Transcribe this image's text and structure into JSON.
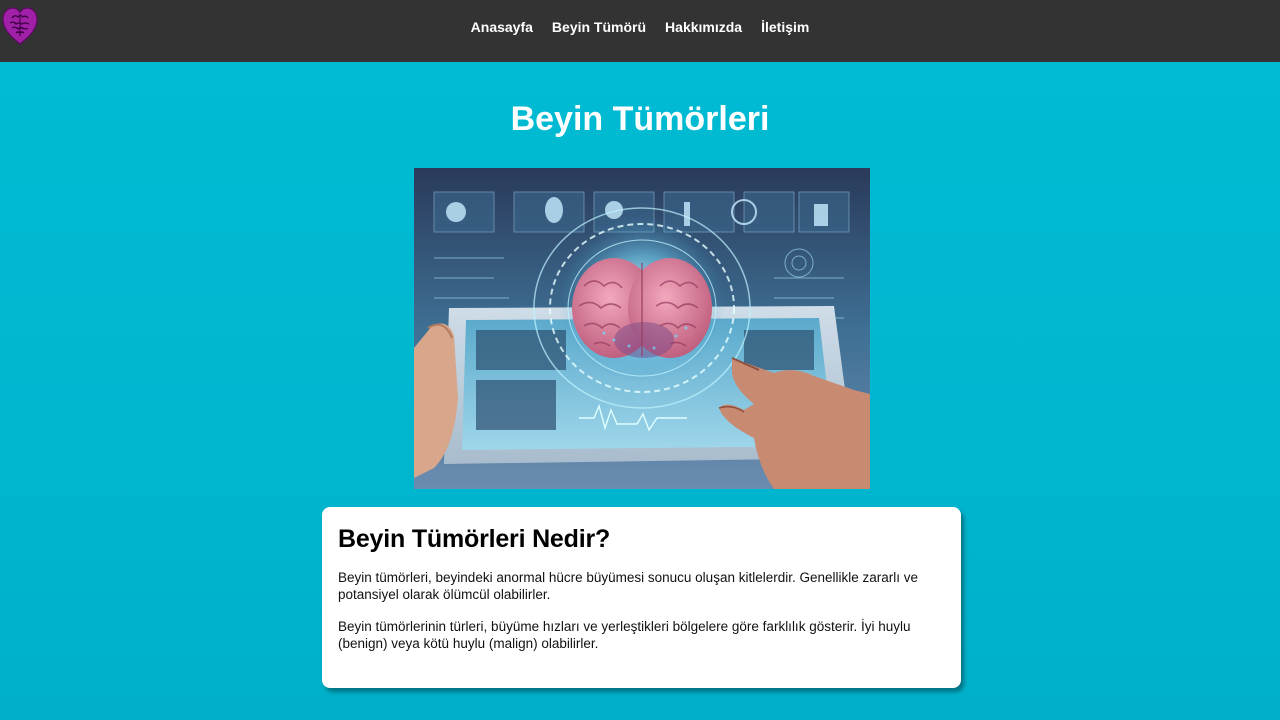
{
  "navbar": {
    "logo_icon": "heart-brain-logo-icon",
    "links": [
      {
        "label": "Anasayfa"
      },
      {
        "label": "Beyin Tümörü"
      },
      {
        "label": "Hakkımızda"
      },
      {
        "label": "İletişim"
      }
    ]
  },
  "main": {
    "title": "Beyin Tümörleri",
    "hero_image": "brain-hologram-tablet-image",
    "card": {
      "heading": "Beyin Tümörleri Nedir?",
      "paragraphs": [
        "Beyin tümörleri, beyindeki anormal hücre büyümesi sonucu oluşan kitlelerdir. Genellikle zararlı ve potansiyel olarak ölümcül olabilirler.",
        "Beyin tümörlerinin türleri, büyüme hızları ve yerleştikleri bölgelere göre farklılık gösterir. İyi huylu (benign) veya kötü huylu (malign) olabilirler."
      ]
    }
  },
  "colors": {
    "navbar_bg": "#333333",
    "page_bg": "#00bcd4",
    "logo": "#9c27b0"
  }
}
